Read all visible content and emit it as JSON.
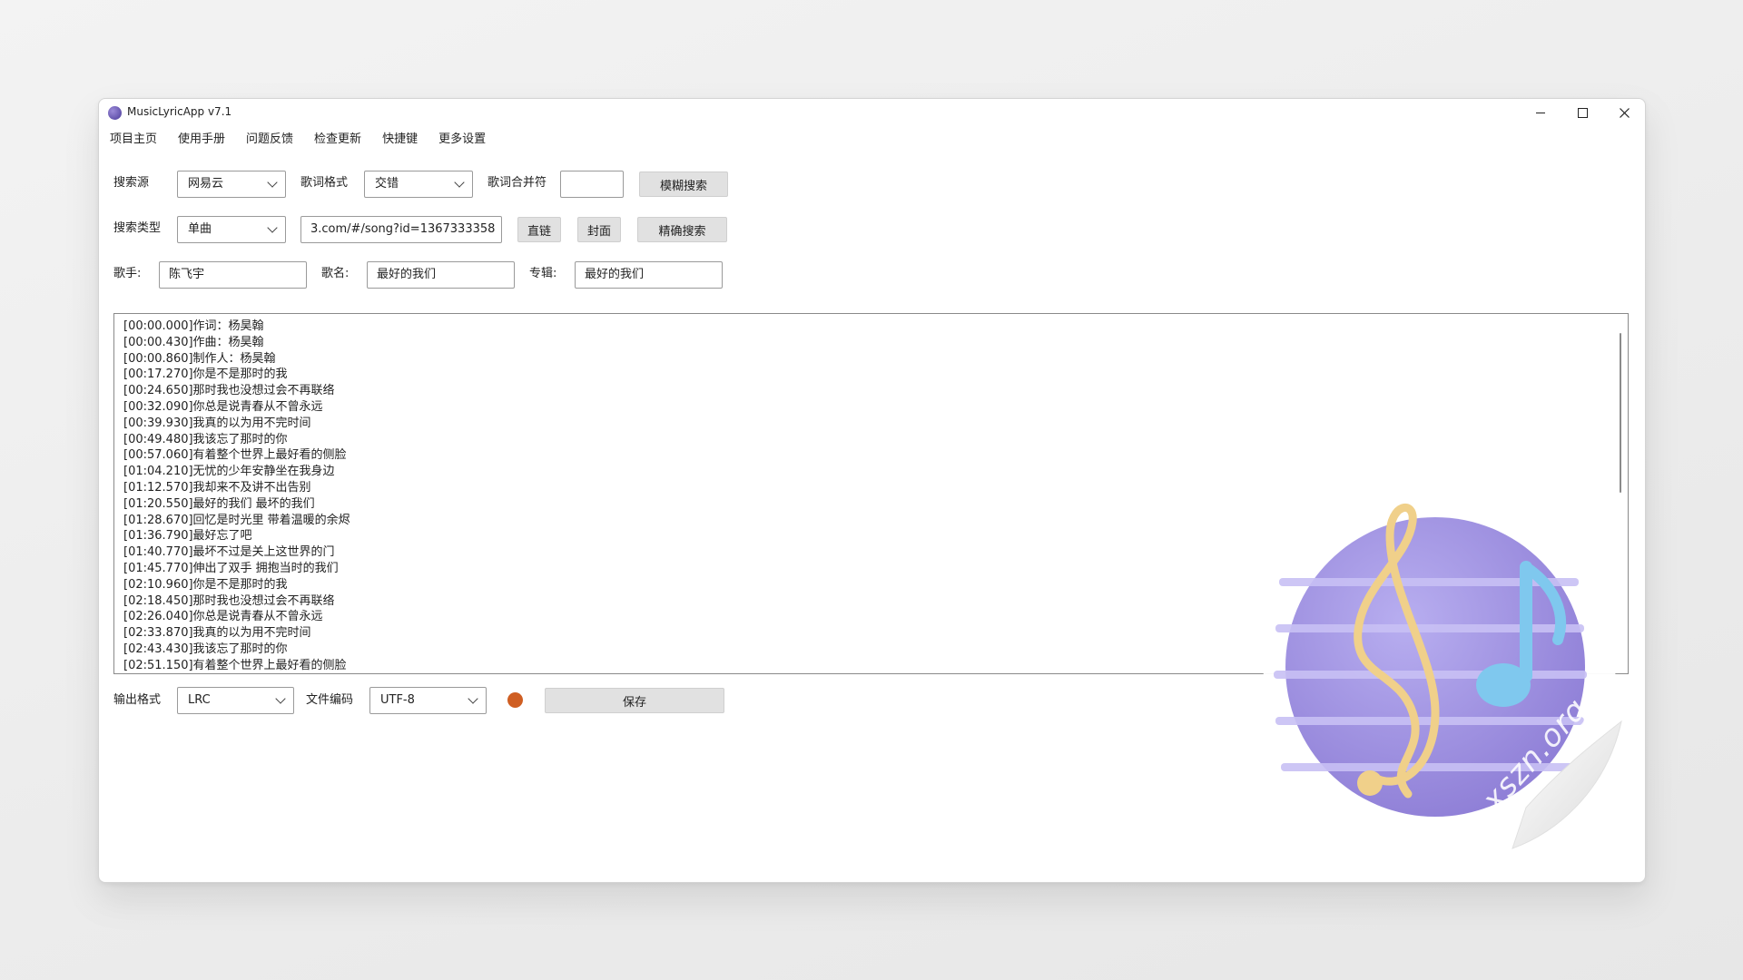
{
  "app": {
    "title": "MusicLyricApp v7.1"
  },
  "menu": [
    "项目主页",
    "使用手册",
    "问题反馈",
    "检查更新",
    "快捷键",
    "更多设置"
  ],
  "row1": {
    "source_label": "搜索源",
    "source_value": "网易云",
    "format_label": "歌词格式",
    "format_value": "交错",
    "merge_label": "歌词合并符",
    "merge_value": "",
    "fuzzy_button": "模糊搜索"
  },
  "row2": {
    "type_label": "搜索类型",
    "type_value": "单曲",
    "url_value": "3.com/#/song?id=1367333358",
    "direct_button": "直链",
    "cover_button": "封面",
    "exact_button": "精确搜索"
  },
  "row3": {
    "singer_label": "歌手:",
    "singer_value": "陈飞宇",
    "song_label": "歌名:",
    "song_value": "最好的我们",
    "album_label": "专辑:",
    "album_value": "最好的我们"
  },
  "lyrics": [
    "[00:00.000]作词：杨昊翰",
    "[00:00.430]作曲：杨昊翰",
    "[00:00.860]制作人：杨昊翰",
    "[00:17.270]你是不是那时的我",
    "[00:24.650]那时我也没想过会不再联络",
    "[00:32.090]你总是说青春从不曾永远",
    "[00:39.930]我真的以为用不完时间",
    "[00:49.480]我该忘了那时的你",
    "[00:57.060]有着整个世界上最好看的侧脸",
    "[01:04.210]无忧的少年安静坐在我身边",
    "[01:12.570]我却来不及讲不出告别",
    "[01:20.550]最好的我们 最坏的我们",
    "[01:28.670]回忆是时光里 带着温暖的余烬",
    "[01:36.790]最好忘了吧",
    "[01:40.770]最坏不过是关上这世界的门",
    "[01:45.770]伸出了双手 拥抱当时的我们",
    "[02:10.960]你是不是那时的我",
    "[02:18.450]那时我也没想过会不再联络",
    "[02:26.040]你总是说青春从不曾永远",
    "[02:33.870]我真的以为用不完时间",
    "[02:43.430]我该忘了那时的你",
    "[02:51.150]有着整个世界上最好看的侧脸"
  ],
  "bottom": {
    "output_label": "输出格式",
    "output_value": "LRC",
    "encoding_label": "文件编码",
    "encoding_value": "UTF-8",
    "status_color": "#cf5e22",
    "save_button": "保存"
  },
  "watermark": "xszn.org"
}
